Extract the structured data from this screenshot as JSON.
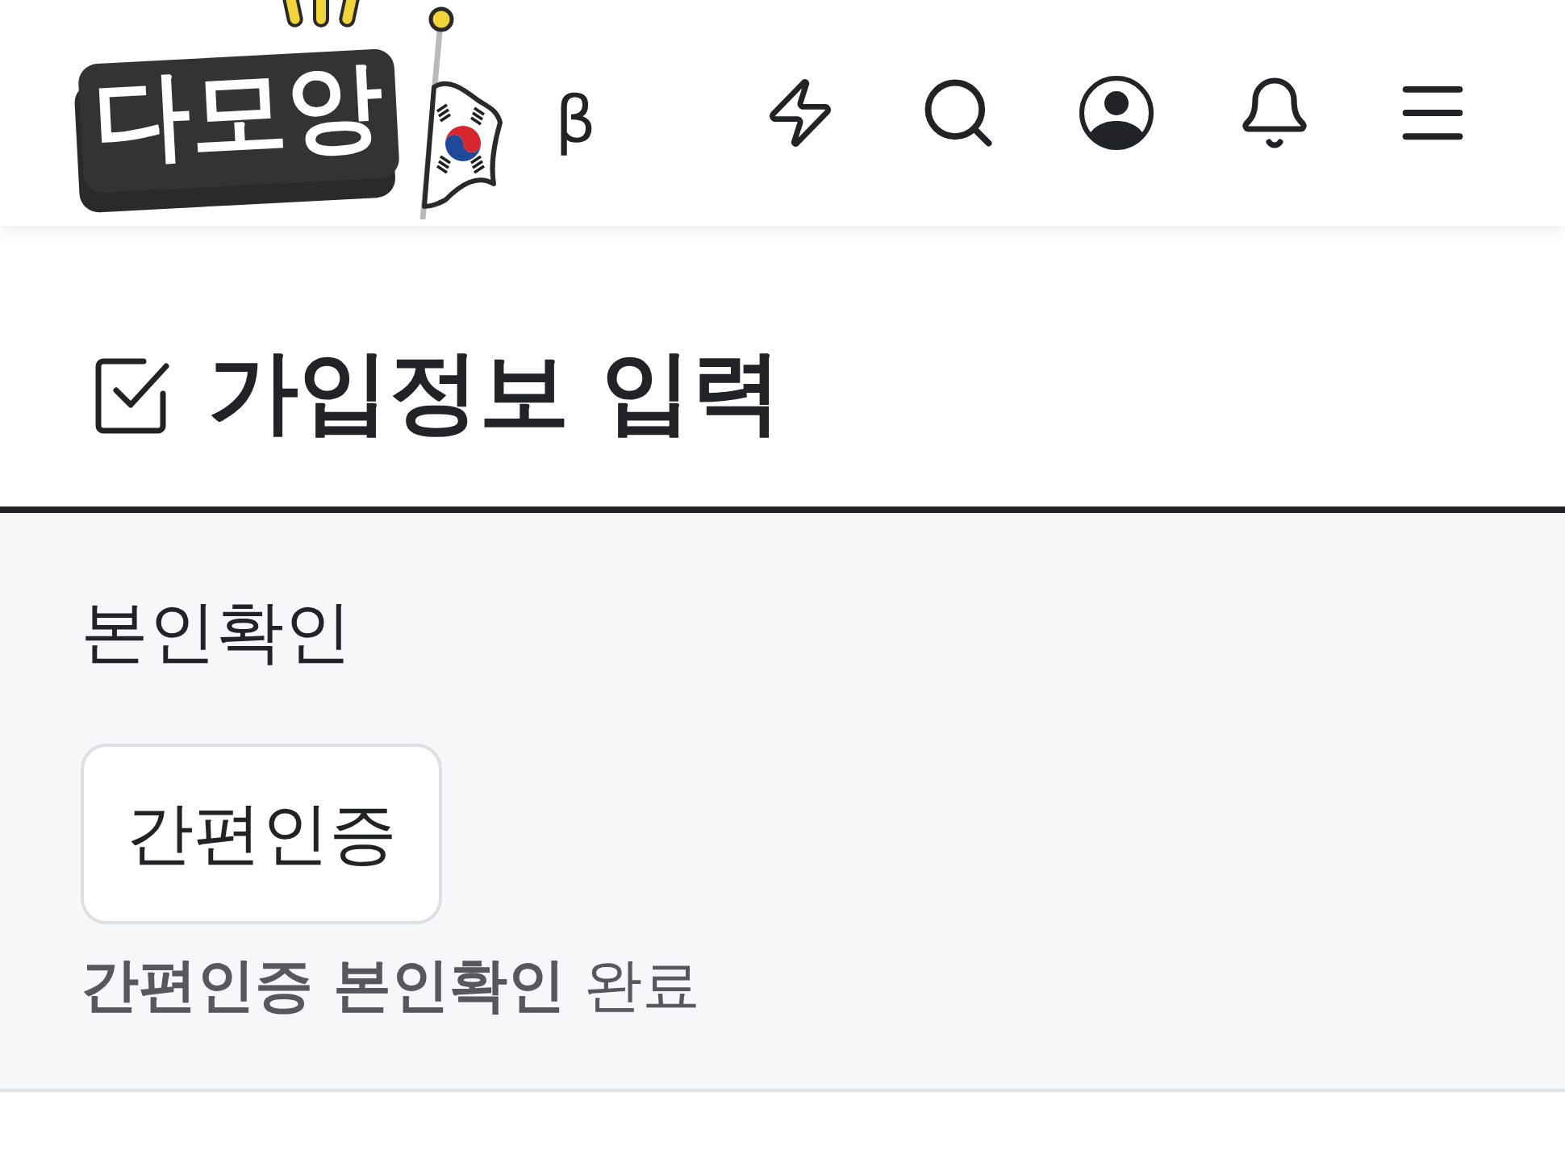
{
  "header": {
    "logo": {
      "text": "다모앙"
    },
    "badge": "β"
  },
  "page_title": "가입정보 입력",
  "section": {
    "label": "본인확인",
    "button": "간편인증",
    "status": "**간편인증 본인확인** 완료"
  }
}
